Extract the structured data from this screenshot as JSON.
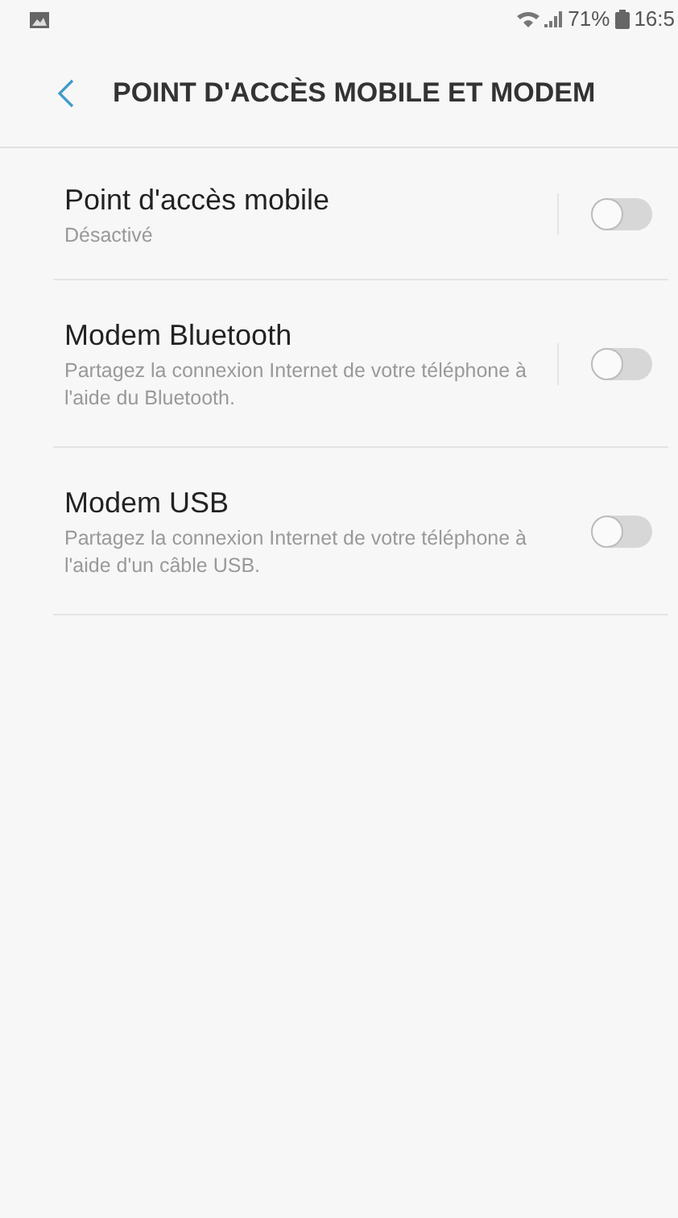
{
  "status_bar": {
    "battery": "71%",
    "time": "16:5"
  },
  "header": {
    "title": "POINT D'ACCÈS MOBILE ET MODEM"
  },
  "items": [
    {
      "kind": "split",
      "title": "Point d'accès mobile",
      "subtitle": "Désactivé",
      "on": false
    },
    {
      "kind": "split",
      "title": "Modem Bluetooth",
      "subtitle": "Partagez la connexion Internet de votre téléphone à l'aide du Bluetooth.",
      "on": false
    },
    {
      "kind": "plain",
      "title": "Modem USB",
      "subtitle": "Partagez la connexion Internet de votre téléphone à l'aide d'un câble USB.",
      "on": false
    }
  ]
}
